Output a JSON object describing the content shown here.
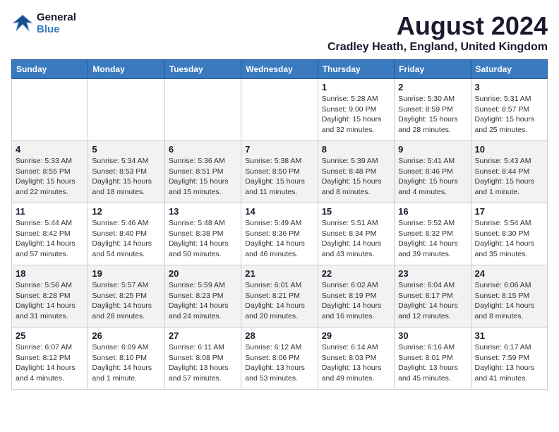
{
  "logo": {
    "line1": "General",
    "line2": "Blue"
  },
  "title": "August 2024",
  "subtitle": "Cradley Heath, England, United Kingdom",
  "days_of_week": [
    "Sunday",
    "Monday",
    "Tuesday",
    "Wednesday",
    "Thursday",
    "Friday",
    "Saturday"
  ],
  "weeks": [
    [
      {
        "day": "",
        "info": ""
      },
      {
        "day": "",
        "info": ""
      },
      {
        "day": "",
        "info": ""
      },
      {
        "day": "",
        "info": ""
      },
      {
        "day": "1",
        "info": "Sunrise: 5:28 AM\nSunset: 9:00 PM\nDaylight: 15 hours\nand 32 minutes."
      },
      {
        "day": "2",
        "info": "Sunrise: 5:30 AM\nSunset: 8:59 PM\nDaylight: 15 hours\nand 28 minutes."
      },
      {
        "day": "3",
        "info": "Sunrise: 5:31 AM\nSunset: 8:57 PM\nDaylight: 15 hours\nand 25 minutes."
      }
    ],
    [
      {
        "day": "4",
        "info": "Sunrise: 5:33 AM\nSunset: 8:55 PM\nDaylight: 15 hours\nand 22 minutes."
      },
      {
        "day": "5",
        "info": "Sunrise: 5:34 AM\nSunset: 8:53 PM\nDaylight: 15 hours\nand 18 minutes."
      },
      {
        "day": "6",
        "info": "Sunrise: 5:36 AM\nSunset: 8:51 PM\nDaylight: 15 hours\nand 15 minutes."
      },
      {
        "day": "7",
        "info": "Sunrise: 5:38 AM\nSunset: 8:50 PM\nDaylight: 15 hours\nand 11 minutes."
      },
      {
        "day": "8",
        "info": "Sunrise: 5:39 AM\nSunset: 8:48 PM\nDaylight: 15 hours\nand 8 minutes."
      },
      {
        "day": "9",
        "info": "Sunrise: 5:41 AM\nSunset: 8:46 PM\nDaylight: 15 hours\nand 4 minutes."
      },
      {
        "day": "10",
        "info": "Sunrise: 5:43 AM\nSunset: 8:44 PM\nDaylight: 15 hours\nand 1 minute."
      }
    ],
    [
      {
        "day": "11",
        "info": "Sunrise: 5:44 AM\nSunset: 8:42 PM\nDaylight: 14 hours\nand 57 minutes."
      },
      {
        "day": "12",
        "info": "Sunrise: 5:46 AM\nSunset: 8:40 PM\nDaylight: 14 hours\nand 54 minutes."
      },
      {
        "day": "13",
        "info": "Sunrise: 5:48 AM\nSunset: 8:38 PM\nDaylight: 14 hours\nand 50 minutes."
      },
      {
        "day": "14",
        "info": "Sunrise: 5:49 AM\nSunset: 8:36 PM\nDaylight: 14 hours\nand 46 minutes."
      },
      {
        "day": "15",
        "info": "Sunrise: 5:51 AM\nSunset: 8:34 PM\nDaylight: 14 hours\nand 43 minutes."
      },
      {
        "day": "16",
        "info": "Sunrise: 5:52 AM\nSunset: 8:32 PM\nDaylight: 14 hours\nand 39 minutes."
      },
      {
        "day": "17",
        "info": "Sunrise: 5:54 AM\nSunset: 8:30 PM\nDaylight: 14 hours\nand 35 minutes."
      }
    ],
    [
      {
        "day": "18",
        "info": "Sunrise: 5:56 AM\nSunset: 8:28 PM\nDaylight: 14 hours\nand 31 minutes."
      },
      {
        "day": "19",
        "info": "Sunrise: 5:57 AM\nSunset: 8:25 PM\nDaylight: 14 hours\nand 28 minutes."
      },
      {
        "day": "20",
        "info": "Sunrise: 5:59 AM\nSunset: 8:23 PM\nDaylight: 14 hours\nand 24 minutes."
      },
      {
        "day": "21",
        "info": "Sunrise: 6:01 AM\nSunset: 8:21 PM\nDaylight: 14 hours\nand 20 minutes."
      },
      {
        "day": "22",
        "info": "Sunrise: 6:02 AM\nSunset: 8:19 PM\nDaylight: 14 hours\nand 16 minutes."
      },
      {
        "day": "23",
        "info": "Sunrise: 6:04 AM\nSunset: 8:17 PM\nDaylight: 14 hours\nand 12 minutes."
      },
      {
        "day": "24",
        "info": "Sunrise: 6:06 AM\nSunset: 8:15 PM\nDaylight: 14 hours\nand 8 minutes."
      }
    ],
    [
      {
        "day": "25",
        "info": "Sunrise: 6:07 AM\nSunset: 8:12 PM\nDaylight: 14 hours\nand 4 minutes."
      },
      {
        "day": "26",
        "info": "Sunrise: 6:09 AM\nSunset: 8:10 PM\nDaylight: 14 hours\nand 1 minute."
      },
      {
        "day": "27",
        "info": "Sunrise: 6:11 AM\nSunset: 8:08 PM\nDaylight: 13 hours\nand 57 minutes."
      },
      {
        "day": "28",
        "info": "Sunrise: 6:12 AM\nSunset: 8:06 PM\nDaylight: 13 hours\nand 53 minutes."
      },
      {
        "day": "29",
        "info": "Sunrise: 6:14 AM\nSunset: 8:03 PM\nDaylight: 13 hours\nand 49 minutes."
      },
      {
        "day": "30",
        "info": "Sunrise: 6:16 AM\nSunset: 8:01 PM\nDaylight: 13 hours\nand 45 minutes."
      },
      {
        "day": "31",
        "info": "Sunrise: 6:17 AM\nSunset: 7:59 PM\nDaylight: 13 hours\nand 41 minutes."
      }
    ]
  ]
}
